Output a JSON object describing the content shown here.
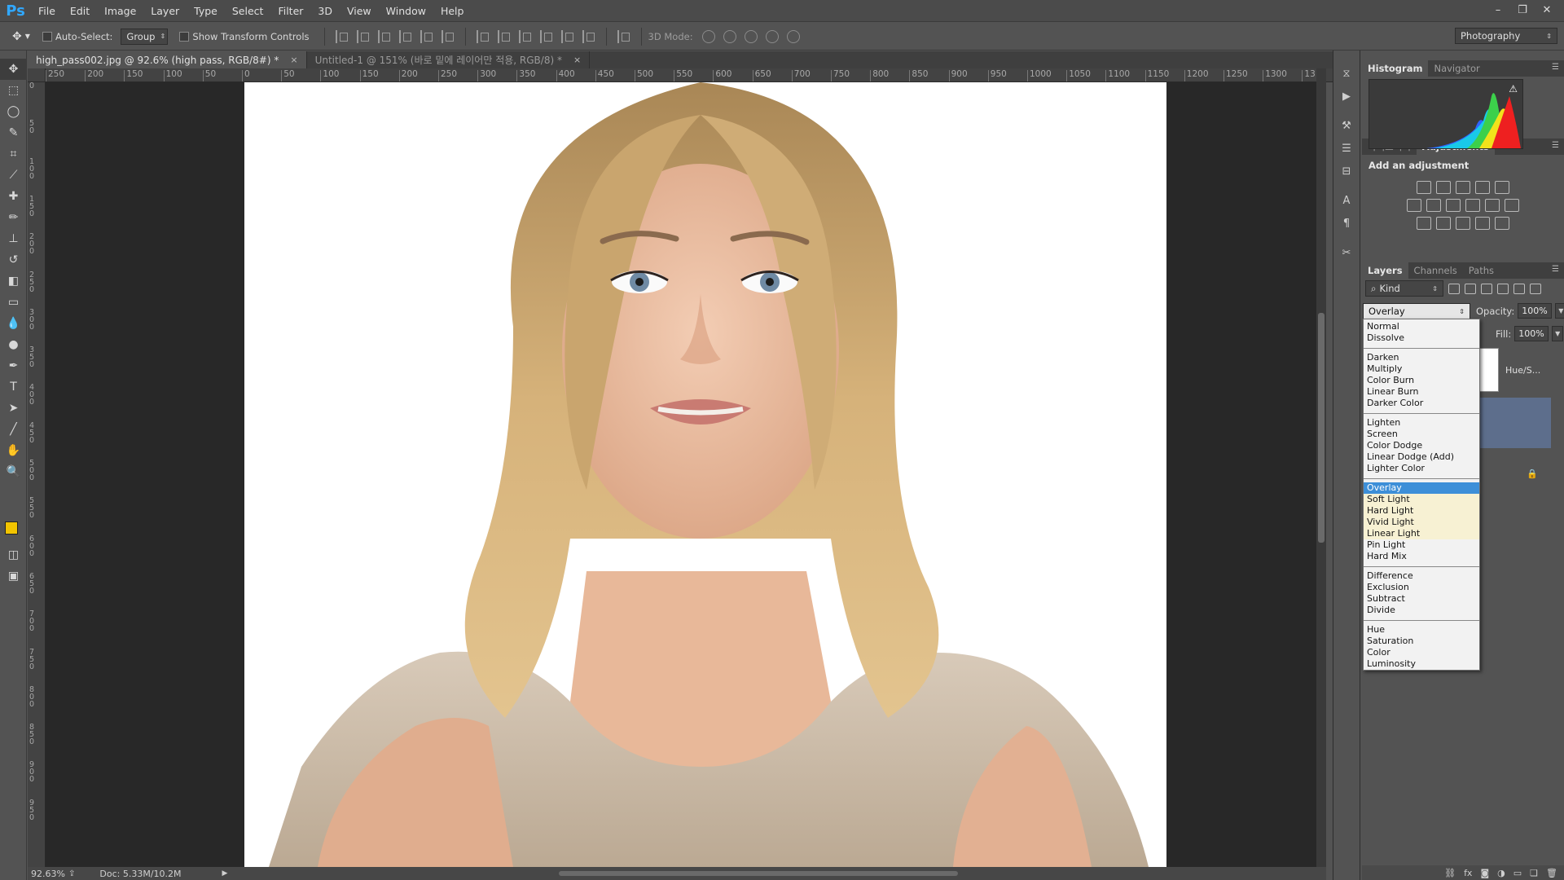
{
  "app": {
    "logo": "Ps",
    "window_controls": [
      "–",
      "❐",
      "✕"
    ]
  },
  "menu": [
    "File",
    "Edit",
    "Image",
    "Layer",
    "Type",
    "Select",
    "Filter",
    "3D",
    "View",
    "Window",
    "Help"
  ],
  "options_bar": {
    "auto_select_label": "Auto-Select:",
    "auto_select_value": "Group",
    "show_transform_label": "Show Transform Controls",
    "mode_3d_label": "3D Mode:",
    "workspace": "Photography"
  },
  "tabs": [
    {
      "label": "high_pass002.jpg @ 92.6% (high pass, RGB/8#) *",
      "close": "×"
    },
    {
      "label": "Untitled-1 @ 151% (바로 밑에 레이어만 적용, RGB/8) *",
      "close": "×"
    }
  ],
  "ruler_h": [
    "250",
    "200",
    "150",
    "100",
    "50",
    "0",
    "50",
    "100",
    "150",
    "200",
    "250",
    "300",
    "350",
    "400",
    "450",
    "500",
    "550",
    "600",
    "650",
    "700",
    "750",
    "800",
    "850",
    "900",
    "950",
    "1000",
    "1050",
    "1100",
    "1150",
    "1200",
    "1250",
    "1300",
    "13"
  ],
  "ruler_v": [
    "0",
    "50",
    "100",
    "150",
    "200",
    "250",
    "300",
    "350",
    "400",
    "450",
    "500",
    "550",
    "600",
    "650",
    "700",
    "750",
    "800",
    "850",
    "900",
    "950"
  ],
  "status": {
    "zoom": "92.63%",
    "doc": "Doc: 5.33M/10.2M",
    "play": "▶"
  },
  "panels": {
    "histogram_tabs": [
      "Histogram",
      "Navigator"
    ],
    "histogram_warning": "⚠",
    "adjust_tabs": [
      "라이브러리",
      "Adjustments"
    ],
    "adjust_title": "Add an adjustment",
    "layers_tabs": [
      "Layers",
      "Channels",
      "Paths"
    ],
    "kind": "Kind",
    "blend_mode": "Overlay",
    "opacity_label": "Opacity:",
    "opacity_value": "100%",
    "fill_label": "Fill:",
    "fill_value": "100%",
    "layer_name": "Hue/S..."
  },
  "blend_groups": [
    [
      "Normal",
      "Dissolve"
    ],
    [
      "Darken",
      "Multiply",
      "Color Burn",
      "Linear Burn",
      "Darker Color"
    ],
    [
      "Lighten",
      "Screen",
      "Color Dodge",
      "Linear Dodge (Add)",
      "Lighter Color"
    ],
    [
      "Overlay",
      "Soft Light",
      "Hard Light",
      "Vivid Light",
      "Linear Light",
      "Pin Light",
      "Hard Mix"
    ],
    [
      "Difference",
      "Exclusion",
      "Subtract",
      "Divide"
    ],
    [
      "Hue",
      "Saturation",
      "Color",
      "Luminosity"
    ]
  ],
  "blend_selected": "Overlay",
  "blend_highlighted": [
    "Soft Light",
    "Hard Light",
    "Vivid Light",
    "Linear Light"
  ],
  "colors": {
    "foreground": "#f2c400",
    "background": "#000000",
    "selected": "#3d8fd8",
    "layer_selected": "#5d6e8c"
  }
}
